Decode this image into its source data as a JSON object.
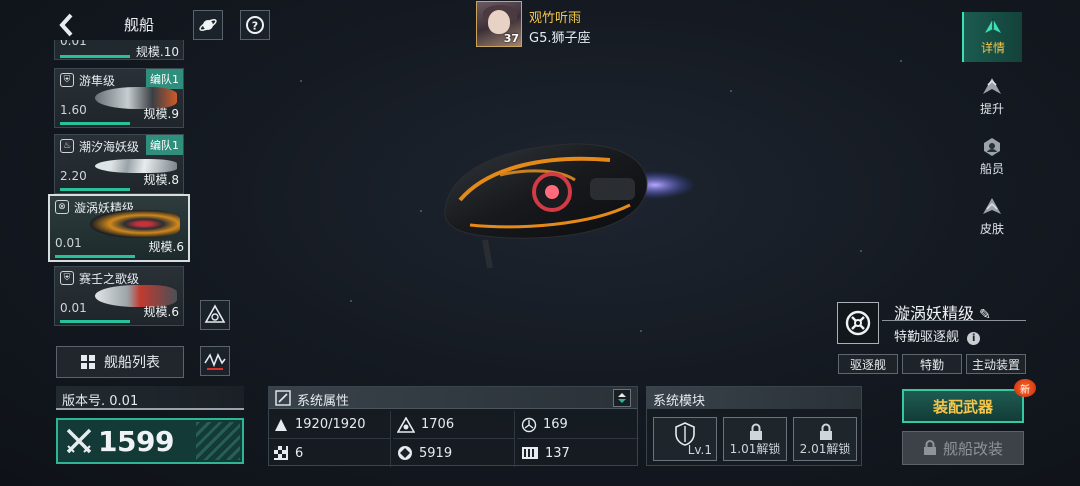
{
  "header": {
    "title": "舰船"
  },
  "player": {
    "name": "观竹听雨",
    "level": "37",
    "rank": "G5.狮子座"
  },
  "ship_list": {
    "top_partial_scale": "规模.10",
    "top_partial_value": "0.01",
    "cards": [
      {
        "name": "游隼级",
        "team": "编队1",
        "value": "1.60",
        "scale": "规模.9"
      },
      {
        "name": "潮汐海妖级",
        "team": "编队1",
        "value": "2.20",
        "scale": "规模.8"
      },
      {
        "name": "漩涡妖精级",
        "team": "",
        "value": "0.01",
        "scale": "规模.6"
      },
      {
        "name": "赛壬之歌级",
        "team": "",
        "value": "0.01",
        "scale": "规模.6"
      }
    ],
    "list_button_label": "舰船列表"
  },
  "version": {
    "label": "版本号. 0.01"
  },
  "power": {
    "value": "1599"
  },
  "attributes": {
    "title": "系统属性",
    "cells": [
      {
        "icon": "hull-icon",
        "value": "1920/1920"
      },
      {
        "icon": "armor-icon",
        "value": "1706"
      },
      {
        "icon": "shield-icon",
        "value": "169"
      },
      {
        "icon": "flag-icon",
        "value": "6"
      },
      {
        "icon": "target-icon",
        "value": "5919"
      },
      {
        "icon": "speed-icon",
        "value": "137"
      }
    ]
  },
  "modules": {
    "title": "系统模块",
    "slots": [
      {
        "label": "Lv.1"
      },
      {
        "label": "1.01解锁"
      },
      {
        "label": "2.01解锁"
      }
    ]
  },
  "actions": {
    "equip": "装配武器",
    "new_badge": "新",
    "modify": "舰船改装"
  },
  "ship_info": {
    "name": "漩涡妖精级",
    "subtype": "特勤驱逐舰",
    "tags": [
      "驱逐舰",
      "特勤",
      "主动装置"
    ]
  },
  "right_nav": [
    {
      "label": "详情",
      "active": true
    },
    {
      "label": "提升",
      "active": false
    },
    {
      "label": "船员",
      "active": false
    },
    {
      "label": "皮肤",
      "active": false
    }
  ],
  "colors": {
    "accent": "#2fb496",
    "gold": "#f5c64a",
    "team_badge": "#2f8f7c"
  }
}
